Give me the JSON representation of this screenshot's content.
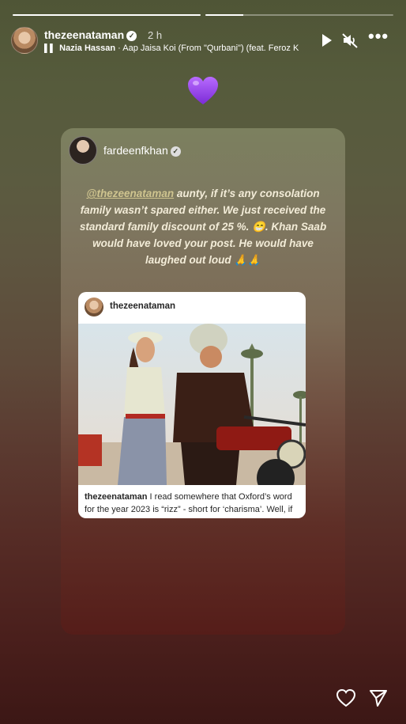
{
  "story": {
    "progress_segments": [
      1.0,
      0.2
    ]
  },
  "header": {
    "username": "thezeenataman",
    "time": "2 h",
    "music_artist": "Nazia Hassan",
    "music_separator": "·",
    "music_title": "Aap Jaisa Koi (From \"Qurbani\") (feat. Feroz K"
  },
  "shared_post": {
    "author": "fardeenfkhan",
    "mention": "@thezeenataman",
    "text": " aunty, if it’s any consolation family wasn’t spared either. We just received the standard family discount of 25 %. 😁.  Khan Saab would have loved your post. He would have laughed out loud 🙏🙏",
    "embedded": {
      "username": "thezeenataman",
      "caption_user": "thezeenataman",
      "caption_text": " I read somewhere that Oxford’s word for the year 2023 is “rizz” - short for ‘charisma’. Well, if I’ve..."
    }
  },
  "icons": {
    "top_emoji": "purple-heart-icon",
    "play": "play-icon",
    "mute": "mute-icon",
    "more": "more-icon",
    "like": "heart-icon",
    "share": "send-icon"
  }
}
